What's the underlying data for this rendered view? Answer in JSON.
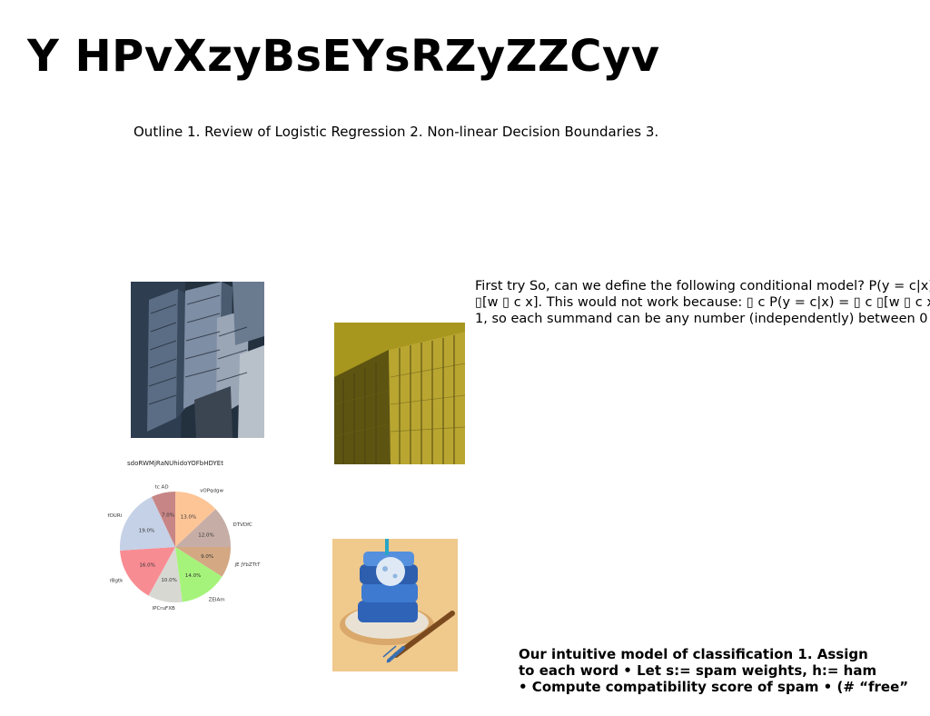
{
  "title": "Y HPvXzyBsEYsRZyZZCyv",
  "outline": "Outline 1. Review of Logistic Regression 2. Non-linear Decision Boundaries 3.",
  "paragraph": [
    "First try So, can we define the following conditional model? P(y = c|x)",
    "▯[w ▯ c x]. This would not work because: ▯ c P(y = c|x) = ▯ c ▯[w ▯ c x]",
    "1, so each summand can be any number (independently) between 0"
  ],
  "bold_text": [
    "Our intuitive model of classification 1. Assign",
    "to each word • Let s:= spam weights, h:= ham",
    "• Compute compatibility score of spam • (# “free”"
  ],
  "images": {
    "city": "aerial-skyscrapers-photo",
    "gold": "gold-glass-building-photo",
    "cake": "blue-cake-photo"
  },
  "chart_data": {
    "type": "pie",
    "title": "sdoRWMjRaNUhidoYOFbHDYEt",
    "slices": [
      {
        "label": "vOPqdgw",
        "value": 13.0,
        "pct": "13.0%",
        "color": "#fdc596"
      },
      {
        "label": "DTVDfC",
        "value": 12.0,
        "pct": "12.0%",
        "color": "#c6ada6"
      },
      {
        "label": "jE JYbZTtT",
        "value": 9.0,
        "pct": "9.0%",
        "color": "#d3a883"
      },
      {
        "label": "ZEIAm",
        "value": 14.0,
        "pct": "14.0%",
        "color": "#a6f37b"
      },
      {
        "label": "lPCruFXB",
        "value": 10.0,
        "pct": "10.0%",
        "color": "#d8d8d3"
      },
      {
        "label": "rBgtk",
        "value": 16.0,
        "pct": "16.0%",
        "color": "#f88c93"
      },
      {
        "label": "fOURi",
        "value": 19.0,
        "pct": "19.0%",
        "color": "#c5d1e6"
      },
      {
        "label": "tc AD",
        "value": 7.0,
        "pct": "7.0%",
        "color": "#c88586"
      }
    ],
    "start_angle_deg": 0,
    "direction": "clockwise"
  }
}
